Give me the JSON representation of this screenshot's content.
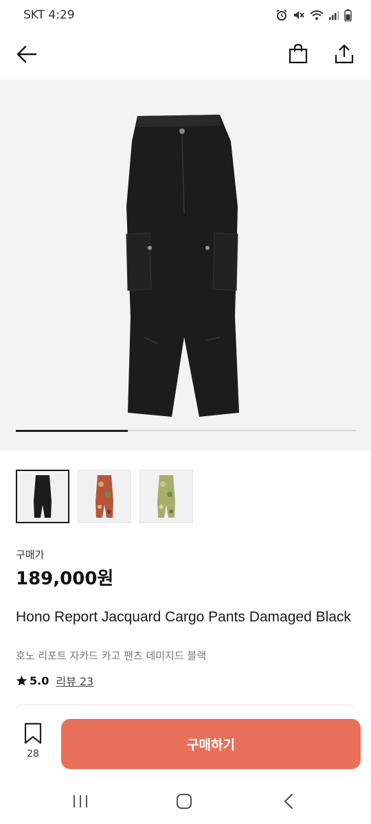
{
  "status_bar": {
    "carrier_time": "SKT 4:29",
    "icons": [
      "alarm-icon",
      "mute-icon",
      "wifi-icon",
      "signal-icon",
      "battery-icon"
    ]
  },
  "top_bar": {
    "icons": [
      "back-arrow-icon",
      "shopping-bag-icon",
      "share-icon"
    ]
  },
  "gallery": {
    "image_position": 1,
    "image_count": 3,
    "progress_fraction": 0.33,
    "thumbnails": [
      {
        "colorway": "black",
        "selected": true
      },
      {
        "colorway": "red-floral",
        "selected": false
      },
      {
        "colorway": "green-floral",
        "selected": false
      }
    ]
  },
  "product": {
    "price_label": "구매가",
    "price": "189,000원",
    "title": "Hono Report Jacquard Cargo Pants Damaged Black",
    "subtitle": "호노 리포트 자카드 카고 팬츠 데미지드 블랙",
    "rating": "5.0",
    "review_link": "리뷰 23"
  },
  "bottom_action": {
    "bookmark_count": "28",
    "buy_label": "구매하기"
  },
  "nav_bar": {
    "icons": [
      "recent-apps-icon",
      "home-icon",
      "back-icon"
    ]
  },
  "colors": {
    "accent": "#e8705a",
    "hero_background": "#f3f3f3",
    "text_primary": "#111111",
    "text_secondary": "#777777"
  }
}
